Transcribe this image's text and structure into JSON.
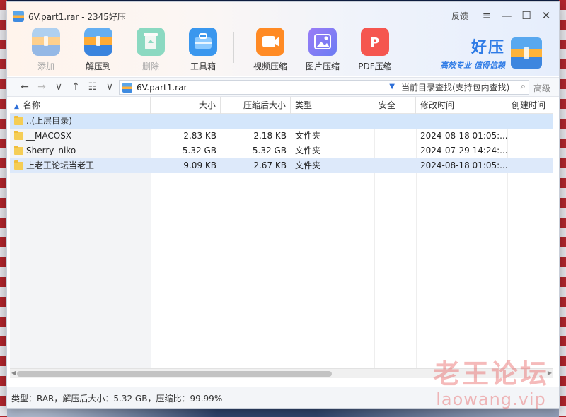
{
  "window": {
    "title": "6V.part1.rar - 2345好压",
    "feedback_label": "反馈",
    "menu_glyph": "≡",
    "minimize_glyph": "—",
    "maximize_glyph": "☐",
    "close_glyph": "✕"
  },
  "toolbar": {
    "add_label": "添加",
    "extract_label": "解压到",
    "delete_label": "删除",
    "toolbox_label": "工具箱",
    "video_label": "视频压缩",
    "image_label": "图片压缩",
    "pdf_label": "PDF压缩"
  },
  "brand": {
    "name": "好压",
    "slogan": "高效专业  值得信赖"
  },
  "nav": {
    "back": "←",
    "forward": "→",
    "down": "∨",
    "up": "↑",
    "view": "☷",
    "view_dd": "∨"
  },
  "address": {
    "path": "6V.part1.rar",
    "search_placeholder": "当前目录查找(支持包内查找)",
    "advanced_label": "高级"
  },
  "columns": {
    "name": "名称",
    "size": "大小",
    "packed": "压缩后大小",
    "type": "类型",
    "security": "安全",
    "modified": "修改时间",
    "created": "创建时间"
  },
  "parent_row": {
    "label": "..(上层目录)"
  },
  "files": [
    {
      "name": "__MACOSX",
      "size": "2.83 KB",
      "packed": "2.18 KB",
      "type": "文件夹",
      "security": "",
      "modified": "2024-08-18 01:05:..."
    },
    {
      "name": "Sherry_niko",
      "size": "5.32 GB",
      "packed": "5.32 GB",
      "type": "文件夹",
      "security": "",
      "modified": "2024-07-29 14:24:..."
    },
    {
      "name": "上老王论坛当老王",
      "size": "9.09 KB",
      "packed": "2.67 KB",
      "type": "文件夹",
      "security": "",
      "modified": "2024-08-18 01:05:..."
    }
  ],
  "status": {
    "text": "类型：RAR，解压后大小：5.32 GB，压缩比：99.99%"
  },
  "watermark": {
    "line1": "老王论坛",
    "line2": "laowang.vip"
  }
}
